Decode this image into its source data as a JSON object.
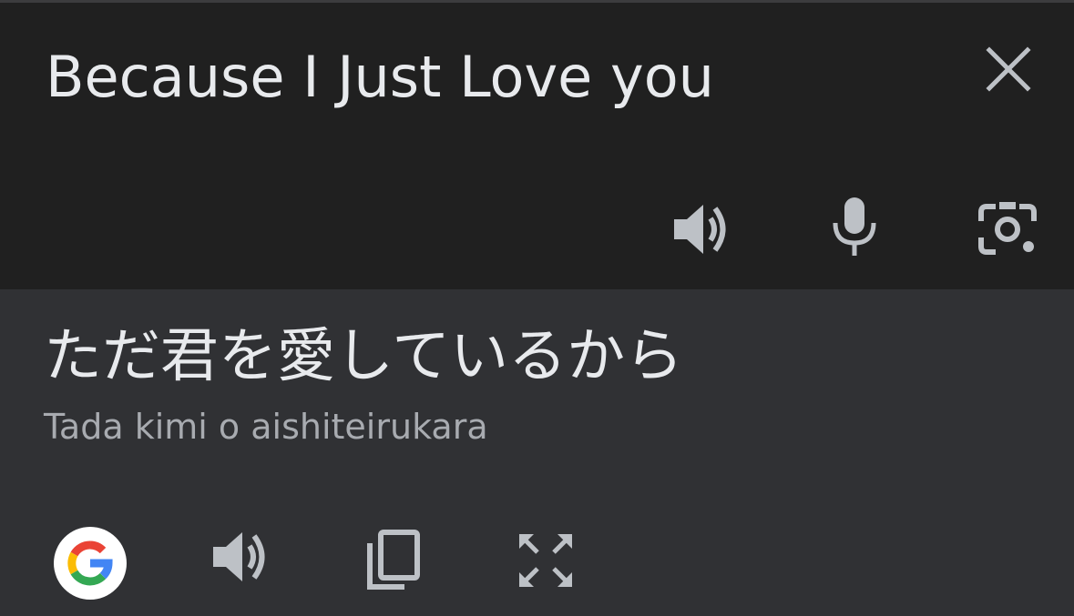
{
  "source": {
    "text": "Because I Just Love you",
    "icons": [
      "close-icon",
      "speaker-icon",
      "microphone-icon",
      "camera-icon"
    ]
  },
  "translation": {
    "text": "ただ君を愛しているから",
    "romanization": "Tada kimi o aishiteirukara",
    "icons": [
      "google-logo",
      "speaker-icon",
      "copy-icon",
      "fullscreen-icon"
    ]
  },
  "colors": {
    "source_background": "#202020",
    "target_background": "#303134",
    "primary_text": "#e8eaed",
    "secondary_text": "#a8abb0",
    "icon": "#bdc1c6"
  }
}
